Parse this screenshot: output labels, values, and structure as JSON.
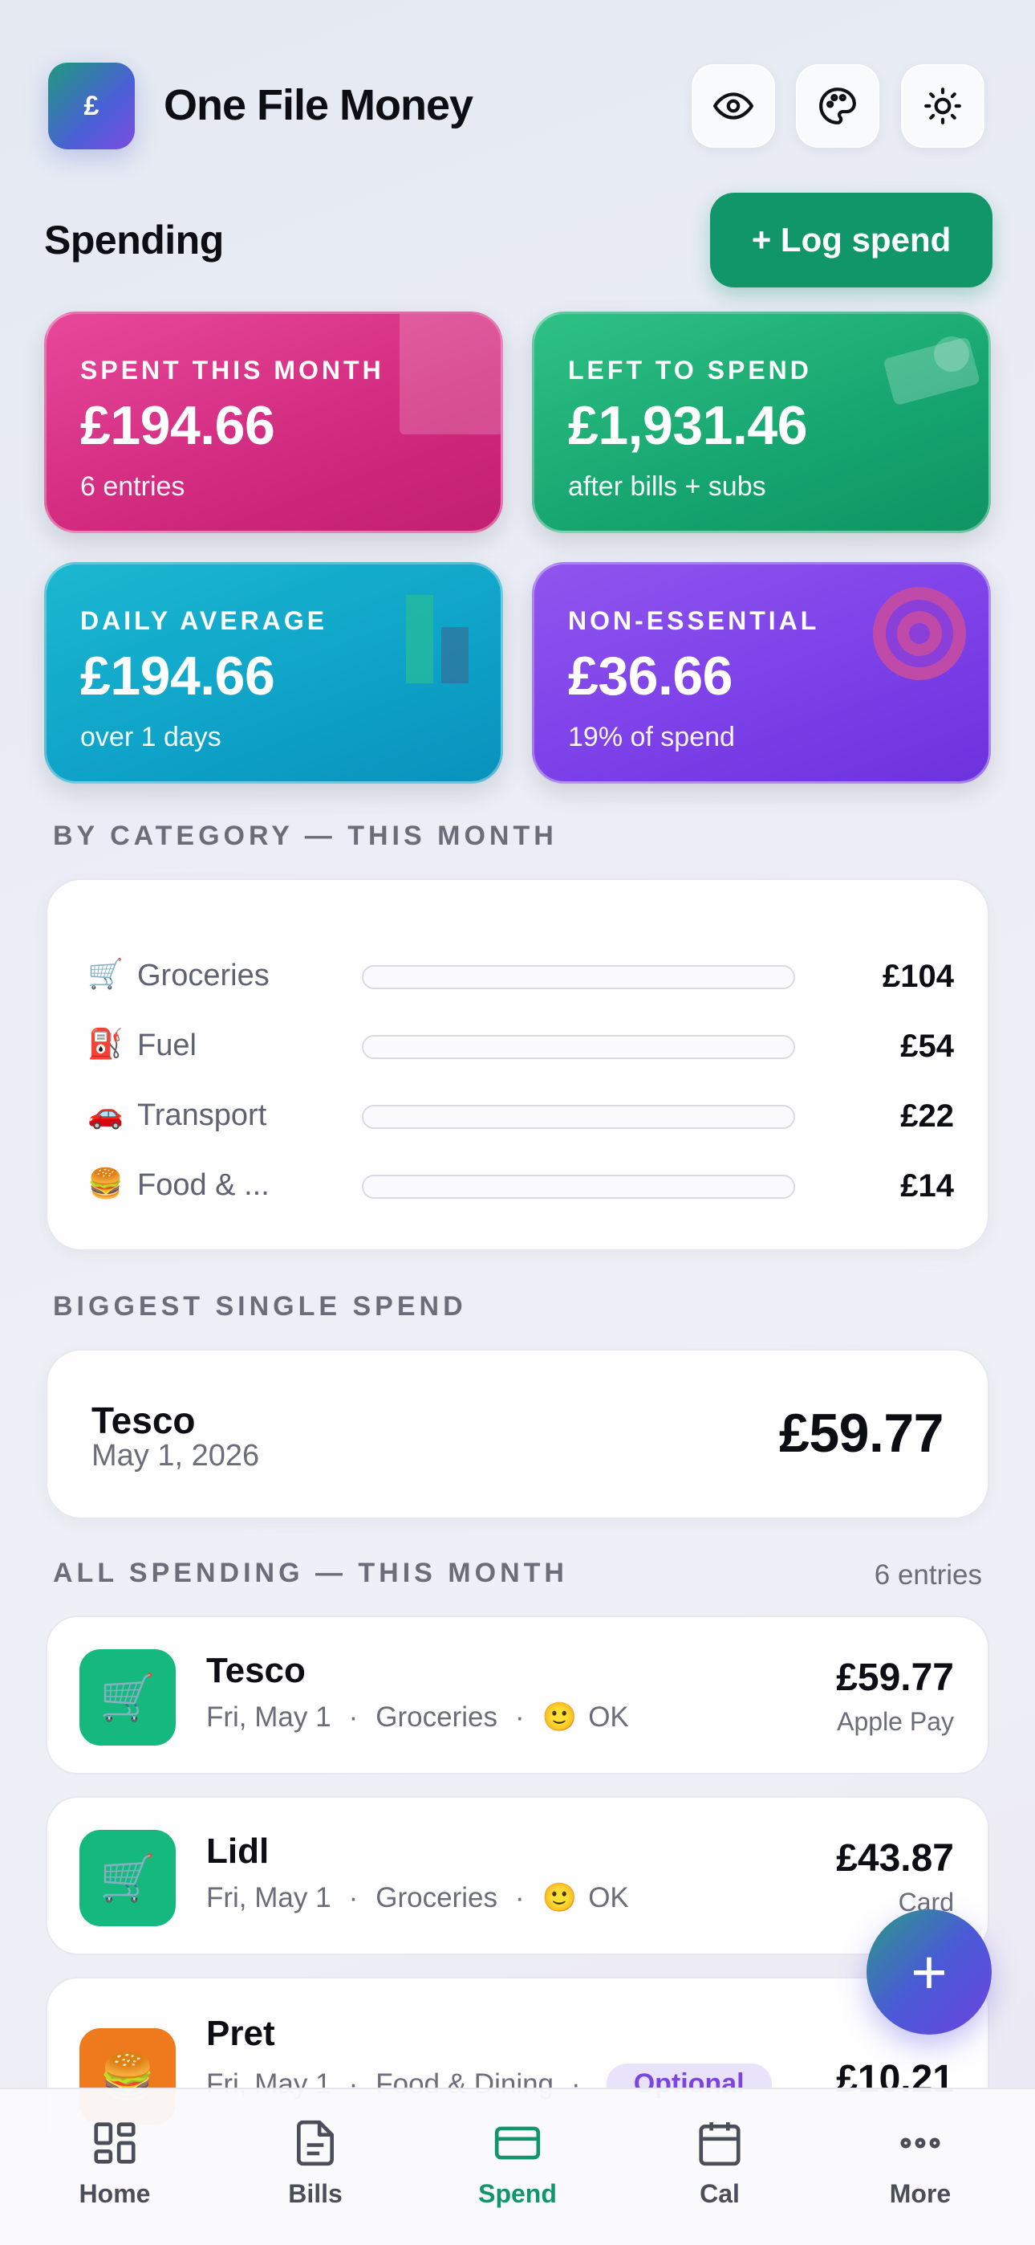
{
  "app": {
    "logo_glyph": "£",
    "title": "One File Money",
    "header_icons": [
      "eye-icon",
      "palette-icon",
      "sun-icon"
    ]
  },
  "section": {
    "title": "Spending",
    "log_button": "+ Log spend"
  },
  "stats": [
    {
      "label": "SPENT THIS MONTH",
      "value": "£194.66",
      "sub": "6 entries",
      "color": "#d63a88"
    },
    {
      "label": "LEFT TO SPEND",
      "value": "£1,931.46",
      "sub": "after bills + subs",
      "color": "#16a56f"
    },
    {
      "label": "DAILY AVERAGE",
      "value": "£194.66",
      "sub": "over 1 days",
      "color": "#0ea2c8"
    },
    {
      "label": "NON-ESSENTIAL",
      "value": "£36.66",
      "sub": "19% of spend",
      "color": "#7b3fe8"
    }
  ],
  "by_category": {
    "caption": "BY CATEGORY — THIS MONTH",
    "rows": [
      {
        "emoji": "🛒",
        "name": "Groceries",
        "amount": "£104"
      },
      {
        "emoji": "⛽",
        "name": "Fuel",
        "amount": "£54"
      },
      {
        "emoji": "🚗",
        "name": "Transport",
        "amount": "£22"
      },
      {
        "emoji": "🍔",
        "name": "Food & ...",
        "amount": "£14"
      }
    ]
  },
  "biggest": {
    "caption": "BIGGEST SINGLE SPEND",
    "name": "Tesco",
    "date": "May 1, 2026",
    "amount": "£59.77"
  },
  "all_spending": {
    "caption": "ALL SPENDING — THIS MONTH",
    "count": "6 entries",
    "items": [
      {
        "icon": "🛒",
        "icon_color": "#15b97e",
        "name": "Tesco",
        "date": "Fri, May 1",
        "category": "Groceries",
        "mood_emoji": "🙂",
        "mood": "OK",
        "amount": "£59.77",
        "method": "Apple Pay"
      },
      {
        "icon": "🛒",
        "icon_color": "#15b97e",
        "name": "Lidl",
        "date": "Fri, May 1",
        "category": "Groceries",
        "mood_emoji": "🙂",
        "mood": "OK",
        "amount": "£43.87",
        "method": "Card"
      },
      {
        "icon": "🍔",
        "icon_color": "#ef7a1e",
        "name": "Pret",
        "date": "Fri, May 1",
        "category": "Food & Dining",
        "badge": "Optional",
        "amount": "£10.21"
      }
    ]
  },
  "fab": "+",
  "nav": [
    {
      "label": "Home",
      "icon": "home-grid-icon"
    },
    {
      "label": "Bills",
      "icon": "document-icon"
    },
    {
      "label": "Spend",
      "icon": "card-icon",
      "active": true
    },
    {
      "label": "Cal",
      "icon": "calendar-icon"
    },
    {
      "label": "More",
      "icon": "more-dots-icon"
    }
  ]
}
